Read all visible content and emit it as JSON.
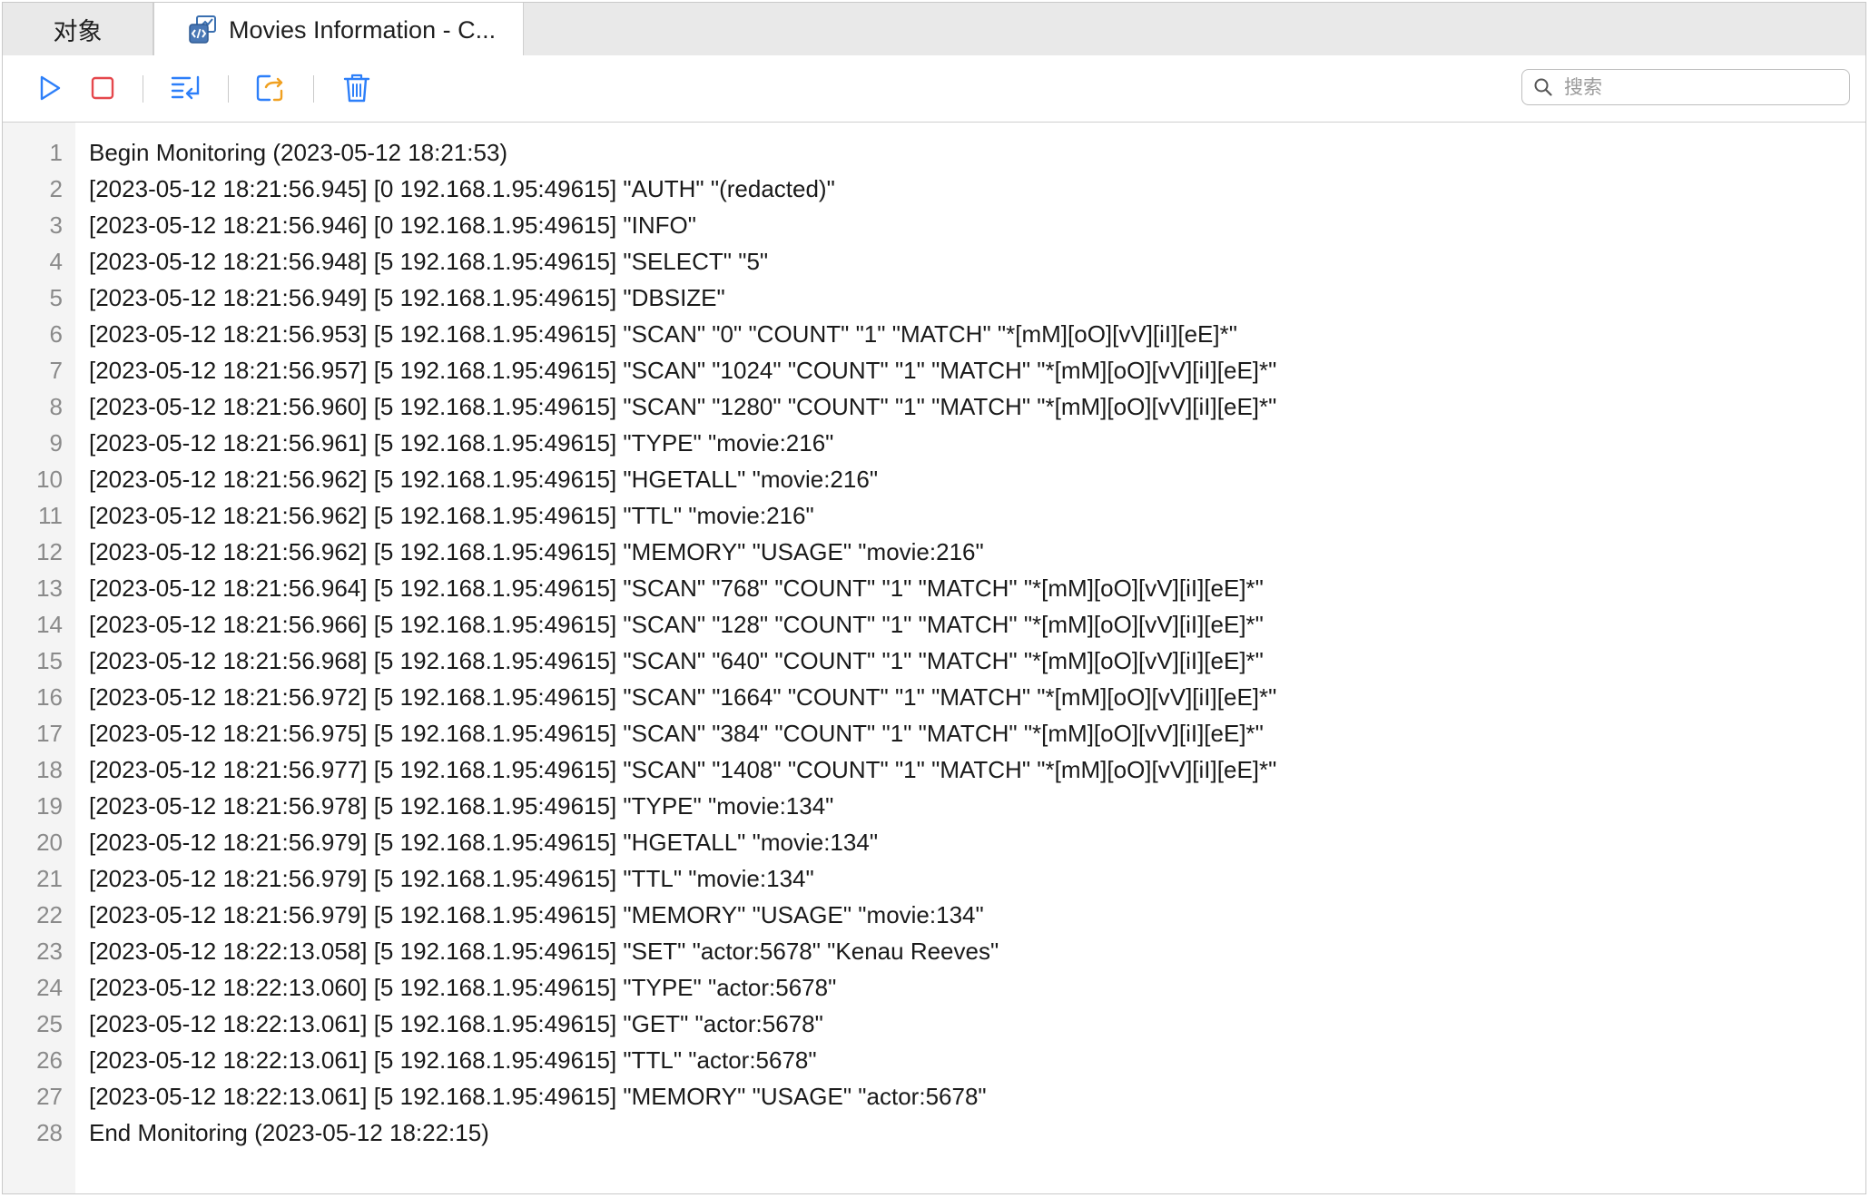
{
  "tabs": [
    {
      "label": "对象"
    },
    {
      "label": "Movies Information - C..."
    }
  ],
  "toolbar": {
    "start": "play-icon",
    "stop": "stop-icon",
    "wrap": "word-wrap-icon",
    "export": "export-icon",
    "clear": "trash-icon"
  },
  "search": {
    "placeholder": "搜索",
    "value": ""
  },
  "colors": {
    "accent_blue": "#2d7ff9",
    "stop_red": "#e5484d",
    "export_orange": "#f0a020",
    "gutter_bg": "#f4f4f4",
    "tabbar_bg": "#e9e9e9"
  },
  "log": [
    {
      "num": "1",
      "text": "Begin Monitoring (2023-05-12 18:21:53)"
    },
    {
      "num": "2",
      "text": "[2023-05-12 18:21:56.945] [0 192.168.1.95:49615] \"AUTH\" \"(redacted)\""
    },
    {
      "num": "3",
      "text": "[2023-05-12 18:21:56.946] [0 192.168.1.95:49615] \"INFO\""
    },
    {
      "num": "4",
      "text": "[2023-05-12 18:21:56.948] [5 192.168.1.95:49615] \"SELECT\" \"5\""
    },
    {
      "num": "5",
      "text": "[2023-05-12 18:21:56.949] [5 192.168.1.95:49615] \"DBSIZE\""
    },
    {
      "num": "6",
      "text": "[2023-05-12 18:21:56.953] [5 192.168.1.95:49615] \"SCAN\" \"0\" \"COUNT\" \"1\" \"MATCH\" \"*[mM][oO][vV][iI][eE]*\""
    },
    {
      "num": "7",
      "text": "[2023-05-12 18:21:56.957] [5 192.168.1.95:49615] \"SCAN\" \"1024\" \"COUNT\" \"1\" \"MATCH\" \"*[mM][oO][vV][iI][eE]*\""
    },
    {
      "num": "8",
      "text": "[2023-05-12 18:21:56.960] [5 192.168.1.95:49615] \"SCAN\" \"1280\" \"COUNT\" \"1\" \"MATCH\" \"*[mM][oO][vV][iI][eE]*\""
    },
    {
      "num": "9",
      "text": "[2023-05-12 18:21:56.961] [5 192.168.1.95:49615] \"TYPE\" \"movie:216\""
    },
    {
      "num": "10",
      "text": "[2023-05-12 18:21:56.962] [5 192.168.1.95:49615] \"HGETALL\" \"movie:216\""
    },
    {
      "num": "11",
      "text": "[2023-05-12 18:21:56.962] [5 192.168.1.95:49615] \"TTL\" \"movie:216\""
    },
    {
      "num": "12",
      "text": "[2023-05-12 18:21:56.962] [5 192.168.1.95:49615] \"MEMORY\" \"USAGE\" \"movie:216\""
    },
    {
      "num": "13",
      "text": "[2023-05-12 18:21:56.964] [5 192.168.1.95:49615] \"SCAN\" \"768\" \"COUNT\" \"1\" \"MATCH\" \"*[mM][oO][vV][iI][eE]*\""
    },
    {
      "num": "14",
      "text": "[2023-05-12 18:21:56.966] [5 192.168.1.95:49615] \"SCAN\" \"128\" \"COUNT\" \"1\" \"MATCH\" \"*[mM][oO][vV][iI][eE]*\""
    },
    {
      "num": "15",
      "text": "[2023-05-12 18:21:56.968] [5 192.168.1.95:49615] \"SCAN\" \"640\" \"COUNT\" \"1\" \"MATCH\" \"*[mM][oO][vV][iI][eE]*\""
    },
    {
      "num": "16",
      "text": "[2023-05-12 18:21:56.972] [5 192.168.1.95:49615] \"SCAN\" \"1664\" \"COUNT\" \"1\" \"MATCH\" \"*[mM][oO][vV][iI][eE]*\""
    },
    {
      "num": "17",
      "text": "[2023-05-12 18:21:56.975] [5 192.168.1.95:49615] \"SCAN\" \"384\" \"COUNT\" \"1\" \"MATCH\" \"*[mM][oO][vV][iI][eE]*\""
    },
    {
      "num": "18",
      "text": "[2023-05-12 18:21:56.977] [5 192.168.1.95:49615] \"SCAN\" \"1408\" \"COUNT\" \"1\" \"MATCH\" \"*[mM][oO][vV][iI][eE]*\""
    },
    {
      "num": "19",
      "text": "[2023-05-12 18:21:56.978] [5 192.168.1.95:49615] \"TYPE\" \"movie:134\""
    },
    {
      "num": "20",
      "text": "[2023-05-12 18:21:56.979] [5 192.168.1.95:49615] \"HGETALL\" \"movie:134\""
    },
    {
      "num": "21",
      "text": "[2023-05-12 18:21:56.979] [5 192.168.1.95:49615] \"TTL\" \"movie:134\""
    },
    {
      "num": "22",
      "text": "[2023-05-12 18:21:56.979] [5 192.168.1.95:49615] \"MEMORY\" \"USAGE\" \"movie:134\""
    },
    {
      "num": "23",
      "text": "[2023-05-12 18:22:13.058] [5 192.168.1.95:49615] \"SET\" \"actor:5678\" \"Kenau Reeves\""
    },
    {
      "num": "24",
      "text": "[2023-05-12 18:22:13.060] [5 192.168.1.95:49615] \"TYPE\" \"actor:5678\""
    },
    {
      "num": "25",
      "text": "[2023-05-12 18:22:13.061] [5 192.168.1.95:49615] \"GET\" \"actor:5678\""
    },
    {
      "num": "26",
      "text": "[2023-05-12 18:22:13.061] [5 192.168.1.95:49615] \"TTL\" \"actor:5678\""
    },
    {
      "num": "27",
      "text": "[2023-05-12 18:22:13.061] [5 192.168.1.95:49615] \"MEMORY\" \"USAGE\" \"actor:5678\""
    },
    {
      "num": "28",
      "text": "End Monitoring (2023-05-12 18:22:15)"
    }
  ]
}
